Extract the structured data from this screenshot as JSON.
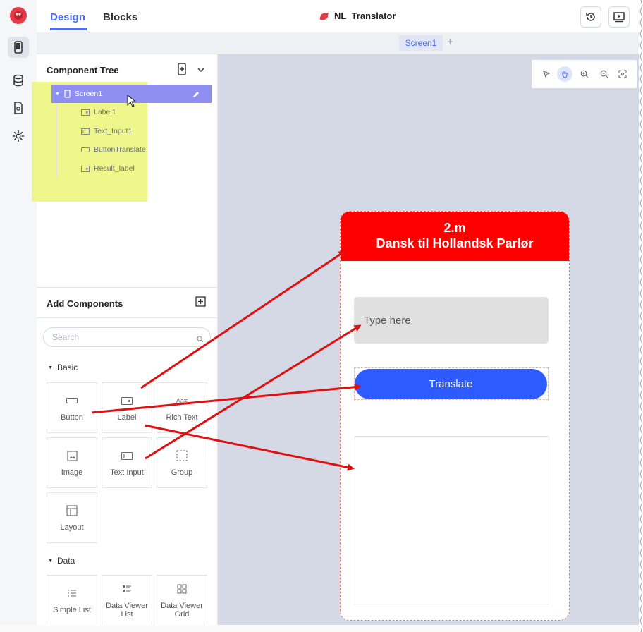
{
  "topbar": {
    "tab_design": "Design",
    "tab_blocks": "Blocks",
    "project_name": "NL_Translator"
  },
  "screens": {
    "current": "Screen1",
    "add": "+"
  },
  "component_tree": {
    "title": "Component Tree",
    "root": "Screen1",
    "children": [
      "Label1",
      "Text_Input1",
      "ButtonTranslate",
      "Result_label"
    ]
  },
  "add_components": {
    "title": "Add Components",
    "search_placeholder": "Search",
    "basic_label": "Basic",
    "basic": [
      "Button",
      "Label",
      "Rich Text",
      "Image",
      "Text Input",
      "Group",
      "Layout"
    ],
    "data_label": "Data",
    "data": [
      "Simple List",
      "Data Viewer List",
      "Data Viewer Grid"
    ]
  },
  "phone": {
    "header_line1": "2.m",
    "header_line2": "Dansk til Hollandsk Parlør",
    "input_placeholder": "Type here",
    "button_label": "Translate"
  },
  "colors": {
    "accent": "#4a6cf7",
    "header_red": "#ff0000",
    "button_blue": "#2d5bff",
    "arrow_red": "#e01010"
  }
}
